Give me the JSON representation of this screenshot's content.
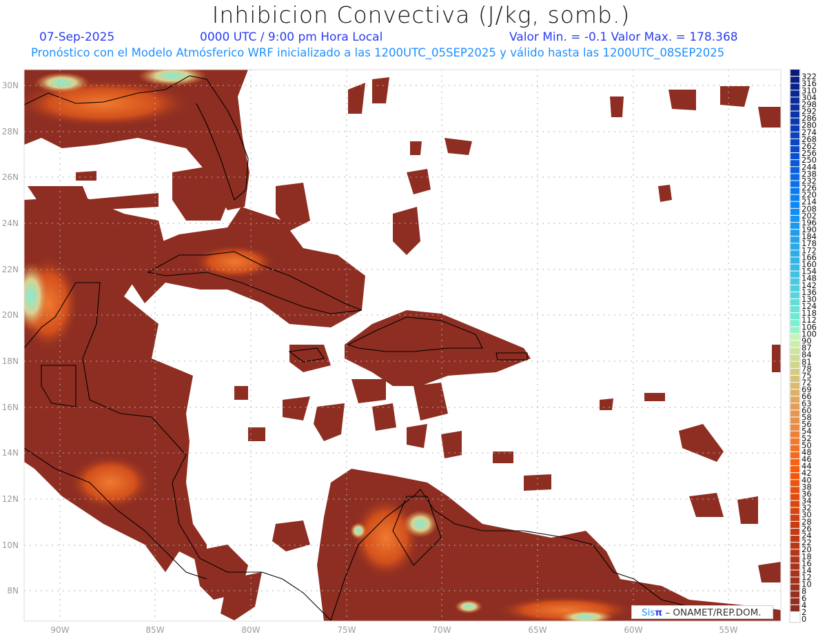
{
  "header": {
    "title": "Inhibicion Convectiva (J/kg, somb.)",
    "date": "07-Sep-2025",
    "time": "0000 UTC / 9:00 pm Hora Local",
    "minmax": "Valor Min. = -0.1  Valor Max. = 178.368",
    "forecast": "Pronóstico con el Modelo Atmósferico WRF inicializado a las 1200UTC_05SEP2025 y válido hasta las  1200UTC_08SEP2025"
  },
  "axes": {
    "lon_labels": [
      "90W",
      "85W",
      "80W",
      "75W",
      "70W",
      "65W",
      "60W",
      "55W"
    ],
    "lat_labels": [
      "30N",
      "28N",
      "26N",
      "24N",
      "22N",
      "20N",
      "18N",
      "16N",
      "14N",
      "12N",
      "10N",
      "8N"
    ]
  },
  "colorbar": {
    "labels": [
      "322",
      "316",
      "310",
      "304",
      "298",
      "292",
      "286",
      "280",
      "274",
      "268",
      "262",
      "256",
      "250",
      "244",
      "238",
      "232",
      "226",
      "220",
      "214",
      "208",
      "202",
      "196",
      "190",
      "184",
      "178",
      "172",
      "166",
      "160",
      "154",
      "148",
      "142",
      "136",
      "130",
      "124",
      "118",
      "112",
      "106",
      "100",
      "90",
      "87",
      "84",
      "81",
      "78",
      "75",
      "72",
      "69",
      "66",
      "63",
      "60",
      "58",
      "56",
      "54",
      "52",
      "50",
      "48",
      "46",
      "44",
      "42",
      "40",
      "38",
      "36",
      "34",
      "32",
      "30",
      "28",
      "26",
      "24",
      "22",
      "20",
      "18",
      "16",
      "14",
      "12",
      "10",
      "8",
      "6",
      "4",
      "2",
      "0"
    ],
    "color_stops": [
      {
        "value": 322,
        "color": "#0a1a7a"
      },
      {
        "value": 250,
        "color": "#0a4fd0"
      },
      {
        "value": 214,
        "color": "#0a82f5"
      },
      {
        "value": 160,
        "color": "#32b4e6"
      },
      {
        "value": 106,
        "color": "#78f0d2"
      },
      {
        "value": 90,
        "color": "#c8f5b4"
      },
      {
        "value": 72,
        "color": "#d7c378"
      },
      {
        "value": 56,
        "color": "#e6914b"
      },
      {
        "value": 42,
        "color": "#fa5a0a"
      },
      {
        "value": 26,
        "color": "#c83c14"
      },
      {
        "value": 2,
        "color": "#8c2d23"
      }
    ]
  },
  "map_colors": {
    "low": "#8e2e22",
    "mid": "#e0581a",
    "high": "#7ee8d8",
    "coast": "#000000"
  },
  "credit": {
    "brand": "Sis",
    "brand_pi": "π",
    "text": " –  ONAMET/REP.DOM."
  }
}
